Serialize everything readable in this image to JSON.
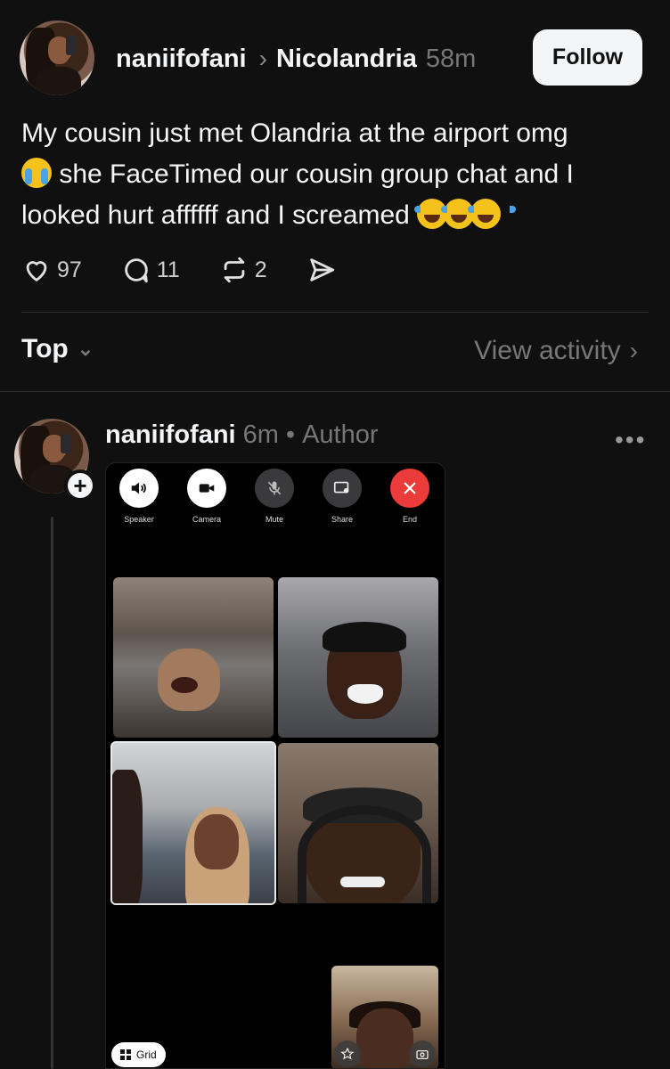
{
  "post": {
    "author": "naniifofani",
    "reply_to": "Nicolandria",
    "time": "58m",
    "follow_label": "Follow",
    "text_line1": "My cousin just met Olandria at the airport omg",
    "text_line2": "she FaceTimed our cousin group chat  and I",
    "text_line3": "looked hurt affffff and I screamed",
    "emoji_cry": "loudly-crying-face",
    "emoji_laugh": "face-with-tears-of-joy",
    "likes": "97",
    "comments": "11",
    "reposts": "2"
  },
  "sort": {
    "label": "Top",
    "view_activity": "View activity"
  },
  "reply": {
    "author": "naniifofani",
    "time": "6m",
    "separator": "•",
    "badge": "Author",
    "more": "•••",
    "plus": "+"
  },
  "facetime": {
    "controls": [
      {
        "label": "Speaker",
        "icon": "speaker-icon"
      },
      {
        "label": "Camera",
        "icon": "camera-icon"
      },
      {
        "label": "Mute",
        "icon": "mic-muted-icon"
      },
      {
        "label": "Share",
        "icon": "share-screen-icon"
      },
      {
        "label": "End",
        "icon": "close-icon"
      }
    ],
    "grid_label": "Grid"
  },
  "colors": {
    "background": "#101010",
    "text": "#f3f5f7",
    "muted": "#777777",
    "end_red": "#eb3b3b"
  }
}
